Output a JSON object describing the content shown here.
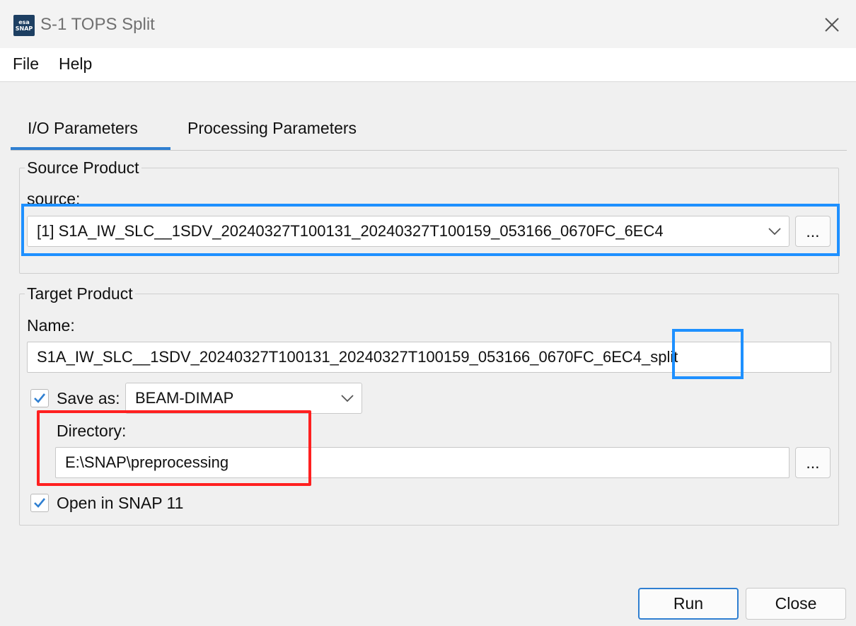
{
  "window": {
    "title": "S-1 TOPS Split",
    "icon_label_top": "esa",
    "icon_label_bottom": "SNAP"
  },
  "menu": {
    "items": [
      "File",
      "Help"
    ]
  },
  "tabs": [
    {
      "label": "I/O Parameters",
      "active": true
    },
    {
      "label": "Processing Parameters",
      "active": false
    }
  ],
  "source_product": {
    "group_title": "Source Product",
    "source_label": "source:",
    "selected": "[1] S1A_IW_SLC__1SDV_20240327T100131_20240327T100159_053166_0670FC_6EC4",
    "browse_label": "..."
  },
  "target_product": {
    "group_title": "Target Product",
    "name_label": "Name:",
    "name_value": "S1A_IW_SLC__1SDV_20240327T100131_20240327T100159_053166_0670FC_6EC4_split",
    "save_as_label": "Save as:",
    "save_as_checked": true,
    "format_value": "BEAM-DIMAP",
    "directory_label": "Directory:",
    "directory_value": "E:\\SNAP\\preprocessing",
    "browse_label": "...",
    "open_in_snap_label": "Open in SNAP 11",
    "open_in_snap_checked": true
  },
  "buttons": {
    "run": "Run",
    "close": "Close"
  },
  "colors": {
    "accent": "#2f7fd1",
    "highlight_blue": "#1e90ff",
    "highlight_red": "#ff2020"
  }
}
